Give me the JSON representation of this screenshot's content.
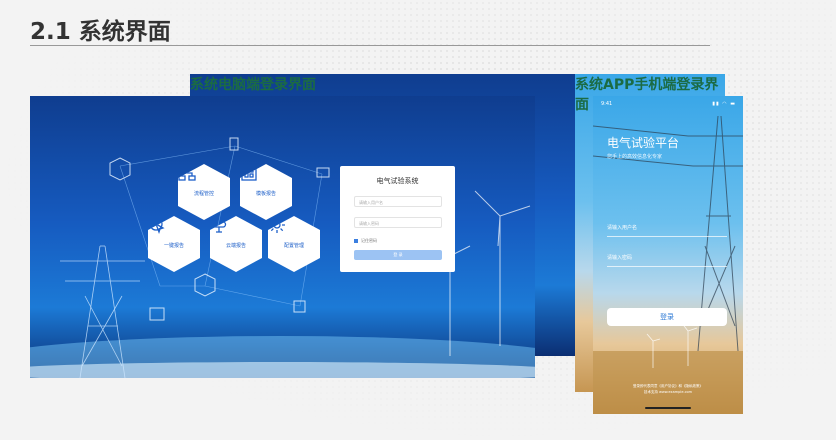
{
  "heading": "2.1 系统界面",
  "captions": {
    "pc": "系统电脑端登录界面",
    "app": "系统APP手机端登录界面"
  },
  "pc_screen": {
    "modules": [
      {
        "label": "流程管控",
        "icon": "flowchart-icon"
      },
      {
        "label": "模板报告",
        "icon": "template-icon"
      },
      {
        "label": "一键报告",
        "icon": "one-click-icon"
      },
      {
        "label": "云端报告",
        "icon": "cloud-icon"
      },
      {
        "label": "配置管理",
        "icon": "gear-icon"
      }
    ],
    "login": {
      "title": "电气试验系统",
      "username_placeholder": "请输入用户名",
      "password_placeholder": "请输入密码",
      "remember": "记住密码",
      "submit": "登 录"
    }
  },
  "app_screen": {
    "time": "9:41",
    "status_icons": "▮▮ ◠ ▬",
    "title": "电气试验平台",
    "subtitle": "您手上的高效信息化专家",
    "username_placeholder": "请输入用户名",
    "password_placeholder": "请输入密码",
    "submit": "登录",
    "footer_line1": "登录即代表同意《用户协议》和《隐私政策》",
    "footer_line2": "技术支持 www.example.com"
  },
  "colors": {
    "heading": "#333333",
    "caption": "#1b6b44",
    "accent": "#1d5fc8"
  }
}
